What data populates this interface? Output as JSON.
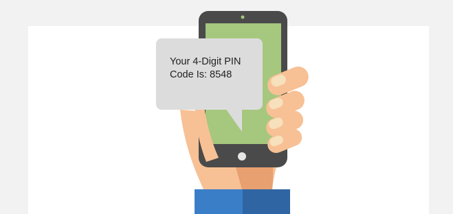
{
  "message": {
    "line1": "Your 4-Digit PIN",
    "line2": "Code Is: 8548"
  },
  "icons": {
    "phone": "smartphone-icon",
    "hand": "hand-illustration",
    "bubble": "speech-bubble"
  },
  "colors": {
    "background": "#f2f2f2",
    "panel": "#ffffff",
    "phone_body": "#4a4a4a",
    "phone_screen": "#a6c77e",
    "bubble": "#dcdcdc",
    "skin": "#f7c195",
    "skin_shadow": "#e8a070",
    "nail": "#f7e0bc",
    "sleeve_light": "#3b7ec8",
    "sleeve_dark": "#2f65a3"
  }
}
